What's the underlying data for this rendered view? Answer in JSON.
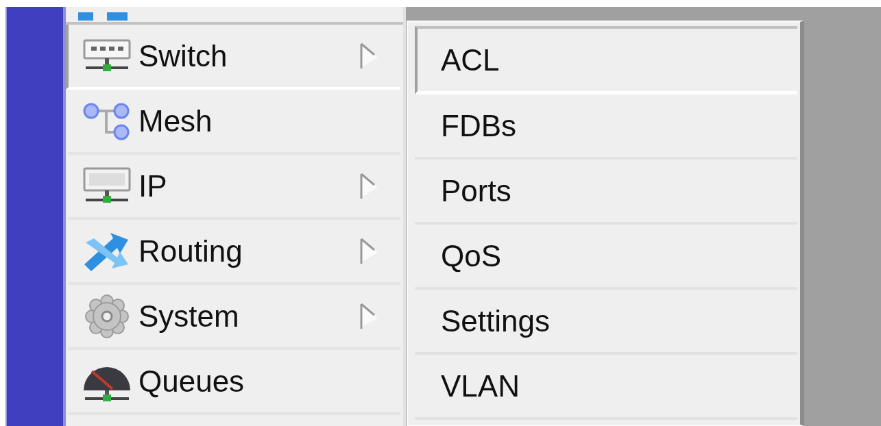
{
  "menu": {
    "items": [
      {
        "label": "Switch",
        "kind": "switch",
        "selected": true,
        "has_submenu": true
      },
      {
        "label": "Mesh",
        "kind": "mesh",
        "selected": false,
        "has_submenu": false
      },
      {
        "label": "IP",
        "kind": "ip",
        "selected": false,
        "has_submenu": true
      },
      {
        "label": "Routing",
        "kind": "routing",
        "selected": false,
        "has_submenu": true
      },
      {
        "label": "System",
        "kind": "system",
        "selected": false,
        "has_submenu": true
      },
      {
        "label": "Queues",
        "kind": "queues",
        "selected": false,
        "has_submenu": false
      }
    ]
  },
  "submenu": {
    "items": [
      {
        "label": "ACL",
        "selected": true
      },
      {
        "label": "FDBs",
        "selected": false
      },
      {
        "label": "Ports",
        "selected": false
      },
      {
        "label": "QoS",
        "selected": false
      },
      {
        "label": "Settings",
        "selected": false
      },
      {
        "label": "VLAN",
        "selected": false
      }
    ]
  }
}
